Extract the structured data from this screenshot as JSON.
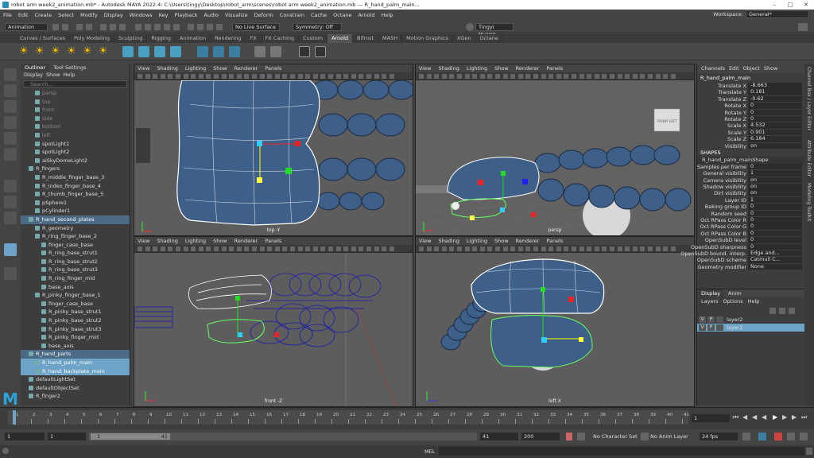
{
  "app": {
    "title": "robot arm week2_animation.mb* - Autodesk MAYA 2022.4: C:\\Users\\tingy\\Desktop\\robot_arm\\scenes\\robot arm week2_animation.mb   ---   R_hand_palm_main...",
    "menus": [
      "File",
      "Edit",
      "Create",
      "Select",
      "Modify",
      "Display",
      "Windows",
      "Key",
      "Playback",
      "Audio",
      "Visualize",
      "Deform",
      "Constrain",
      "Cache",
      "Octane",
      "Arnold",
      "Help"
    ],
    "workspace_label": "Workspace:",
    "workspace_value": "General*"
  },
  "status_line": {
    "mode": "Animation",
    "live_surface": "No Live Surface",
    "symmetry": "Symmetry: Off",
    "user": "Tingyi Huang"
  },
  "shelf": {
    "tabs": [
      "Curves / Surfaces",
      "Poly Modeling",
      "Sculpting",
      "Rigging",
      "Animation",
      "Rendering",
      "FX",
      "FX Caching",
      "Custom",
      "Arnold",
      "Bifrost",
      "MASH",
      "Motion Graphics",
      "XGen",
      "Octane"
    ],
    "active_tab": "Arnold"
  },
  "outliner": {
    "tabs": [
      "Outliner",
      "Tool Settings"
    ],
    "menu": [
      "Display",
      "Show",
      "Help"
    ],
    "search_placeholder": "Search...",
    "items": [
      {
        "label": "persp",
        "state": "dim",
        "indent": 1
      },
      {
        "label": "top",
        "state": "dim",
        "indent": 1
      },
      {
        "label": "front",
        "state": "dim",
        "indent": 1
      },
      {
        "label": "side",
        "state": "dim",
        "indent": 1
      },
      {
        "label": "bottom",
        "state": "dim",
        "indent": 1
      },
      {
        "label": "left",
        "state": "dim",
        "indent": 1
      },
      {
        "label": "spotLight1",
        "state": "normal",
        "indent": 1
      },
      {
        "label": "spotLight2",
        "state": "normal",
        "indent": 1
      },
      {
        "label": "aiSkyDomeLight2",
        "state": "normal",
        "indent": 1
      },
      {
        "label": "R_fingers",
        "state": "normal",
        "indent": 0
      },
      {
        "label": "R_middle_finger_base_3",
        "state": "normal",
        "indent": 1
      },
      {
        "label": "R_index_finger_base_4",
        "state": "normal",
        "indent": 1
      },
      {
        "label": "R_thumb_finger_base_5",
        "state": "normal",
        "indent": 1
      },
      {
        "label": "pSphere1",
        "state": "normal",
        "indent": 1
      },
      {
        "label": "pCylinder1",
        "state": "normal",
        "indent": 1
      },
      {
        "label": "R_hand_second_plates",
        "state": "sel2",
        "indent": 0
      },
      {
        "label": "R_geometry",
        "state": "normal",
        "indent": 1
      },
      {
        "label": "R_ring_finger_base_2",
        "state": "normal",
        "indent": 1
      },
      {
        "label": "finger_case_base",
        "state": "normal",
        "indent": 2
      },
      {
        "label": "R_ring_base_strut1",
        "state": "normal",
        "indent": 2
      },
      {
        "label": "R_ring_base_strut2",
        "state": "normal",
        "indent": 2
      },
      {
        "label": "R_ring_base_strut3",
        "state": "normal",
        "indent": 2
      },
      {
        "label": "R_ring_finger_mid",
        "state": "normal",
        "indent": 2
      },
      {
        "label": "base_axis",
        "state": "normal",
        "indent": 2
      },
      {
        "label": "R_pinky_finger_base_1",
        "state": "normal",
        "indent": 1
      },
      {
        "label": "finger_case_base",
        "state": "normal",
        "indent": 2
      },
      {
        "label": "R_pinky_base_strut1",
        "state": "normal",
        "indent": 2
      },
      {
        "label": "R_pinky_base_strut2",
        "state": "normal",
        "indent": 2
      },
      {
        "label": "R_pinky_base_strut3",
        "state": "normal",
        "indent": 2
      },
      {
        "label": "R_pinky_finger_mid",
        "state": "normal",
        "indent": 2
      },
      {
        "label": "base_axis",
        "state": "normal",
        "indent": 2
      },
      {
        "label": "R_hand_parts",
        "state": "sel2",
        "indent": 0
      },
      {
        "label": "R_hand_palm_main",
        "state": "sel1",
        "indent": 1
      },
      {
        "label": "R_hand_backplate_main",
        "state": "sel1",
        "indent": 1
      },
      {
        "label": "defaultLightSet",
        "state": "normal",
        "indent": 0
      },
      {
        "label": "defaultObjectSet",
        "state": "normal",
        "indent": 0
      },
      {
        "label": "R_finger2",
        "state": "normal",
        "indent": 0
      }
    ]
  },
  "viewports": {
    "menu": [
      "View",
      "Shading",
      "Lighting",
      "Show",
      "Renderer",
      "Panels"
    ],
    "top_label": "top -Y",
    "persp_label": "persp",
    "front_label": "front -Z",
    "left_label": "left X",
    "cube_front": "FRONT",
    "cube_left": "LEFT"
  },
  "channel_box": {
    "menu": [
      "Channels",
      "Edit",
      "Object",
      "Show"
    ],
    "object": "R_hand_palm_main",
    "transform": [
      {
        "name": "Translate X",
        "value": "-8.663"
      },
      {
        "name": "Translate Y",
        "value": "0.181"
      },
      {
        "name": "Translate Z",
        "value": "-0.62"
      },
      {
        "name": "Rotate X",
        "value": "0"
      },
      {
        "name": "Rotate Y",
        "value": "0"
      },
      {
        "name": "Rotate Z",
        "value": "0"
      },
      {
        "name": "Scale X",
        "value": "4.532"
      },
      {
        "name": "Scale Y",
        "value": "0.901"
      },
      {
        "name": "Scale Z",
        "value": "6.184"
      },
      {
        "name": "Visibility",
        "value": "on"
      }
    ],
    "shapes_header": "SHAPES",
    "shape_name": "R_hand_palm_mainShape",
    "shape_attrs": [
      {
        "name": "Samples per frame",
        "value": "0"
      },
      {
        "name": "General visibility",
        "value": "1"
      },
      {
        "name": "Camera visibility",
        "value": "on"
      },
      {
        "name": "Shadow visibility",
        "value": "on"
      },
      {
        "name": "Dirt visibility",
        "value": "on"
      },
      {
        "name": "Layer ID",
        "value": "1"
      },
      {
        "name": "Baking group ID",
        "value": "0"
      },
      {
        "name": "Random seed",
        "value": "0"
      },
      {
        "name": "Oct RPass Color R",
        "value": "0"
      },
      {
        "name": "Oct RPass Color G",
        "value": "0"
      },
      {
        "name": "Oct RPass Color B",
        "value": "0"
      },
      {
        "name": "OpenSubD level",
        "value": "0"
      },
      {
        "name": "OpenSubD sharpness",
        "value": "0"
      },
      {
        "name": "OpenSubD bound. interp.",
        "value": "Edge and..."
      },
      {
        "name": "OpenSubD scheme",
        "value": "Catmull C..."
      },
      {
        "name": "Geometry modifier",
        "value": "None"
      }
    ],
    "side_tabs": [
      "Channel Box / Layer Editor",
      "Attribute Editor",
      "Modeling Toolkit"
    ]
  },
  "layers": {
    "tabs": [
      "Display",
      "Anim"
    ],
    "menu": [
      "Layers",
      "Options",
      "Help"
    ],
    "items": [
      {
        "name": "layer2",
        "selected": false
      },
      {
        "name": "layer1",
        "selected": true
      }
    ],
    "v": "V",
    "p": "P"
  },
  "timeline": {
    "start": 1,
    "end": 41,
    "current_frame": "1",
    "tick_labels": [
      "1",
      "2",
      "3",
      "4",
      "5",
      "6",
      "7",
      "8",
      "9",
      "10",
      "11",
      "12",
      "13",
      "14",
      "15",
      "16",
      "17",
      "18",
      "19",
      "20",
      "21",
      "22",
      "23",
      "24",
      "25",
      "26",
      "27",
      "28",
      "29",
      "30",
      "31",
      "32",
      "33",
      "34",
      "35",
      "36",
      "37",
      "38",
      "39",
      "40",
      "41"
    ]
  },
  "range": {
    "start": "1",
    "playback_start": "1",
    "slider_start": "1",
    "slider_end": "41",
    "playback_end": "41",
    "end": "200",
    "character_set": "No Character Set",
    "anim_layer": "No Anim Layer",
    "fps": "24 fps"
  },
  "mel": {
    "label": "MEL"
  },
  "colors": {
    "accent": "#6da3c6",
    "model_blue": "#3d5f88",
    "wire_blue": "#1a1aaa",
    "grid": "#6a6a6a"
  }
}
